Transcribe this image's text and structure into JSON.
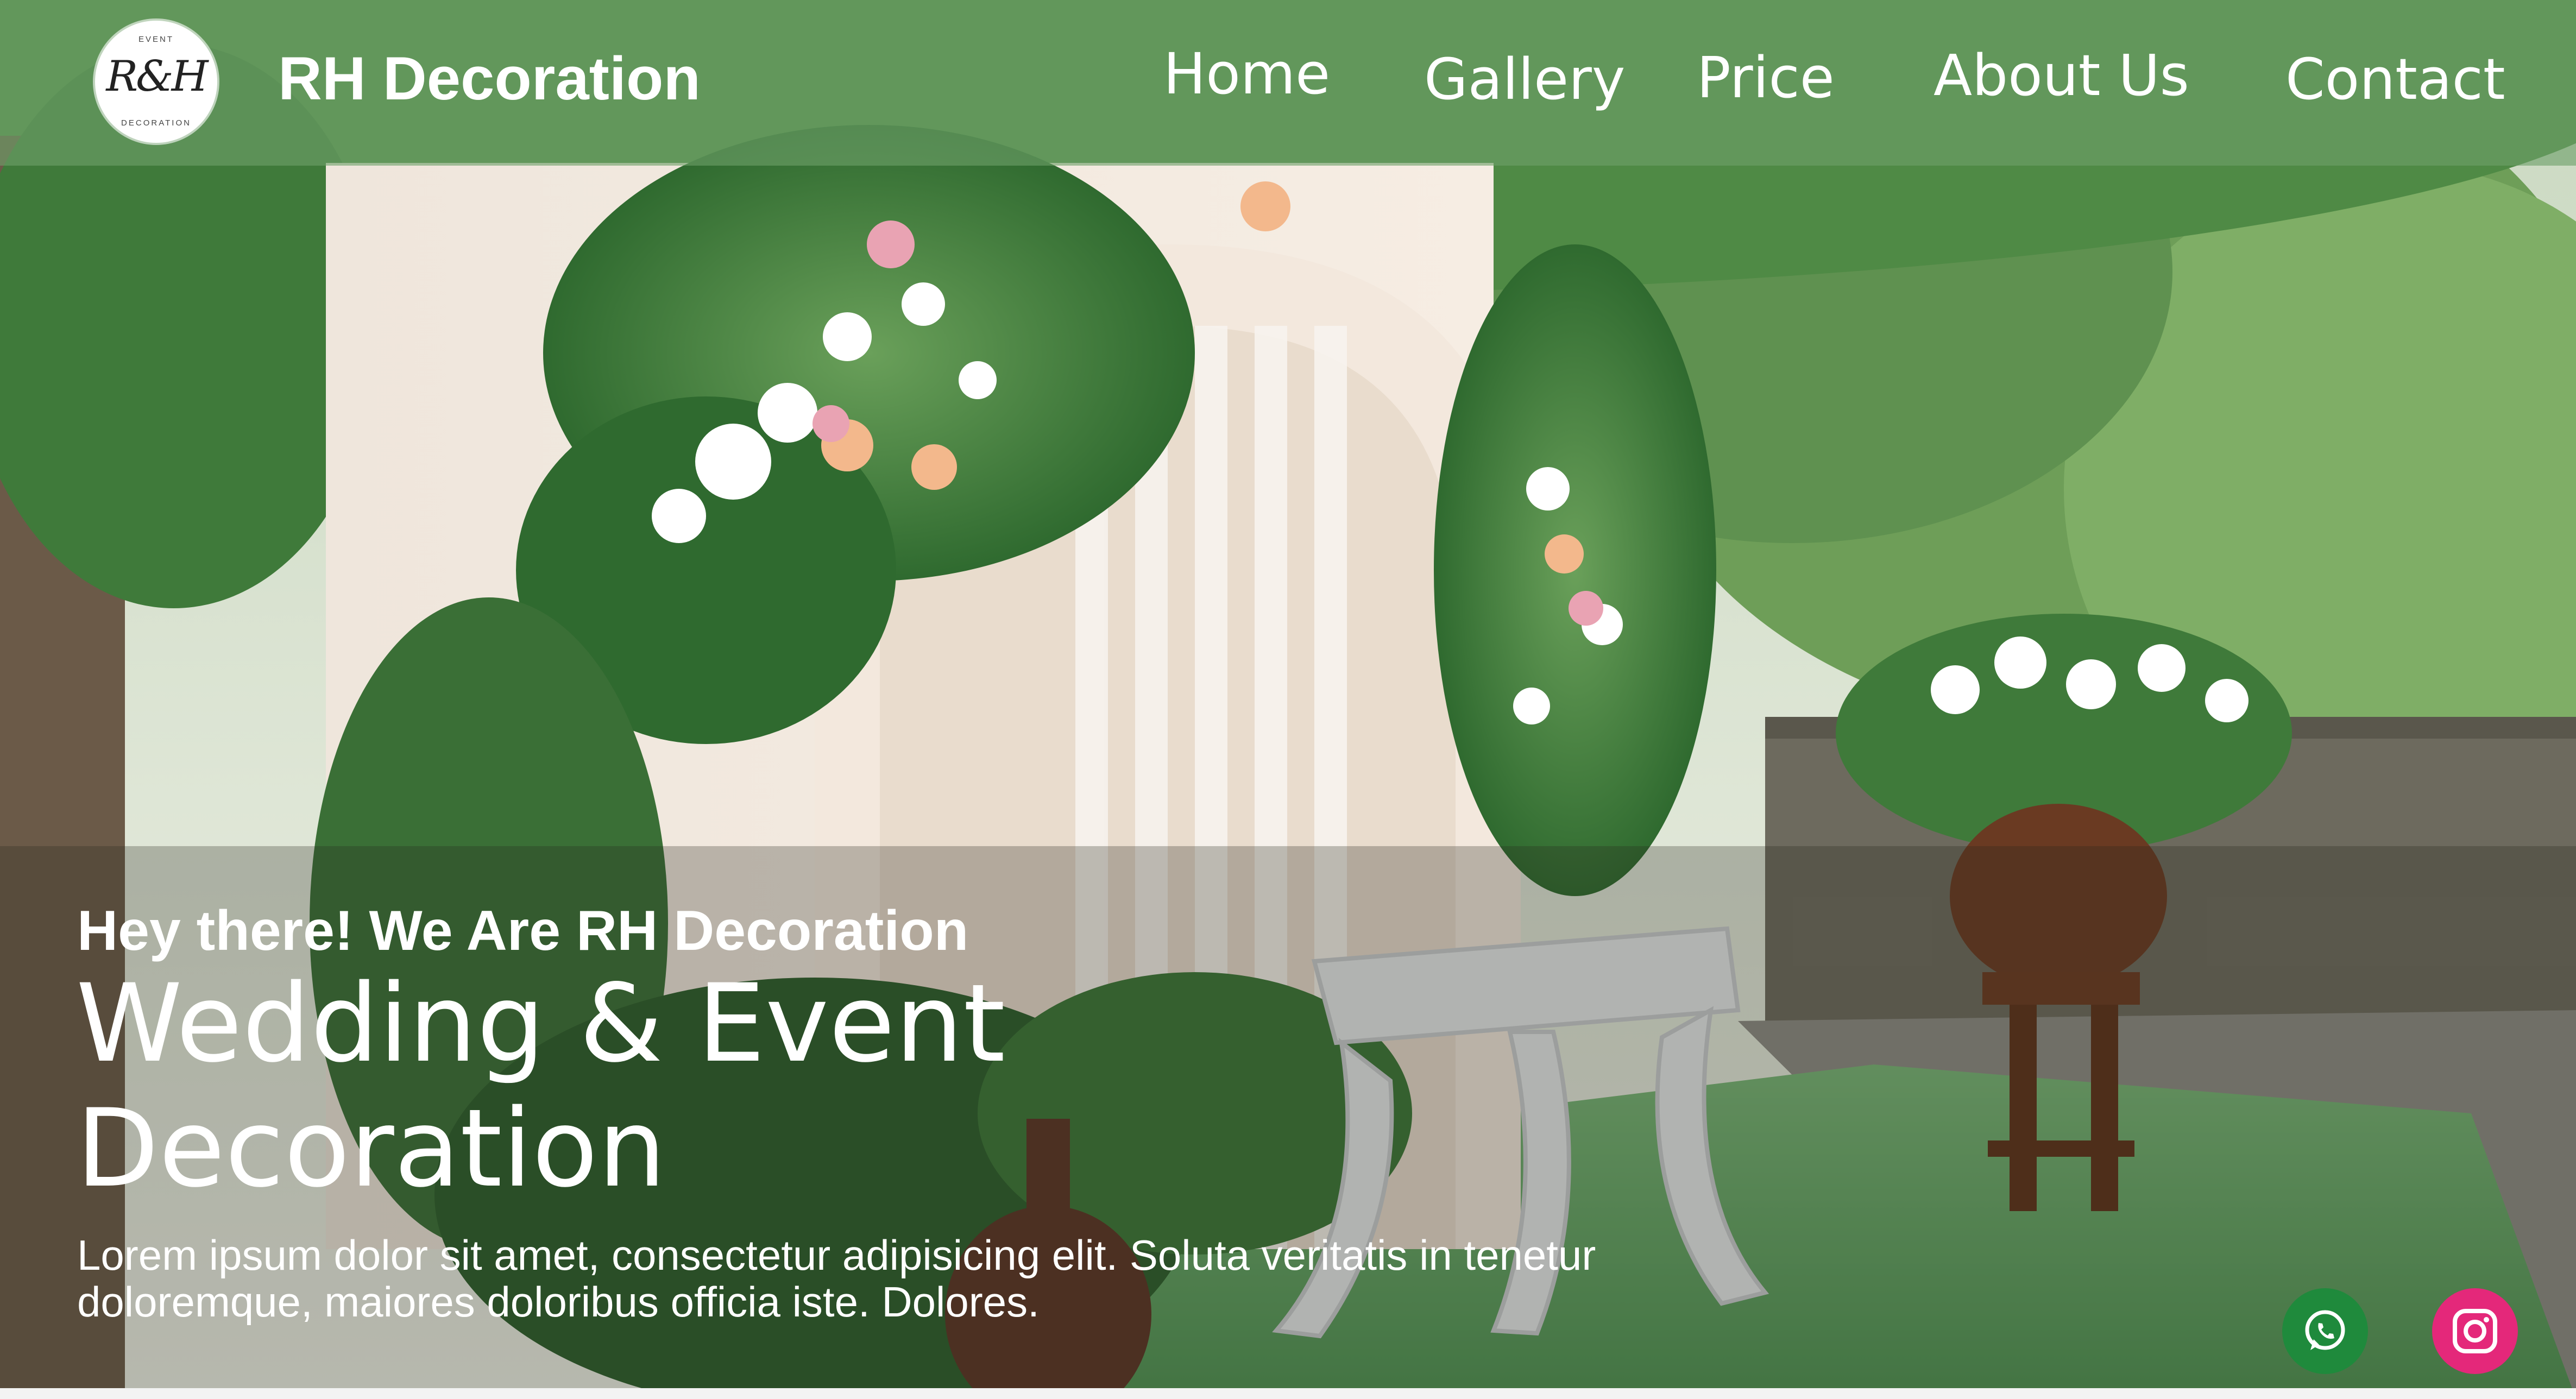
{
  "brand": {
    "name": "RH Decoration",
    "logo_monogram": "R&H",
    "logo_ring_top": "EVENT",
    "logo_ring_bottom": "DECORATION"
  },
  "nav": {
    "items": [
      {
        "label": "Home"
      },
      {
        "label": "Gallery"
      },
      {
        "label": "Price"
      },
      {
        "label": "About Us"
      },
      {
        "label": "Contact"
      }
    ]
  },
  "hero": {
    "greeting": "Hey there! We Are RH Decoration",
    "headline_line1": "Wedding & Event",
    "headline_line2": "Decoration",
    "lead": "Lorem ipsum dolor sit amet, consectetur adipisicing elit. Soluta veritatis in tenetur doloremque, maiores doloribus officia iste. Dolores."
  },
  "social": {
    "whatsapp_icon": "whatsapp-icon",
    "instagram_icon": "instagram-icon",
    "whatsapp_color": "#1f8a3c",
    "instagram_color": "#e4287a"
  },
  "colors": {
    "navbar": "#6ea069",
    "text": "#ffffff"
  }
}
